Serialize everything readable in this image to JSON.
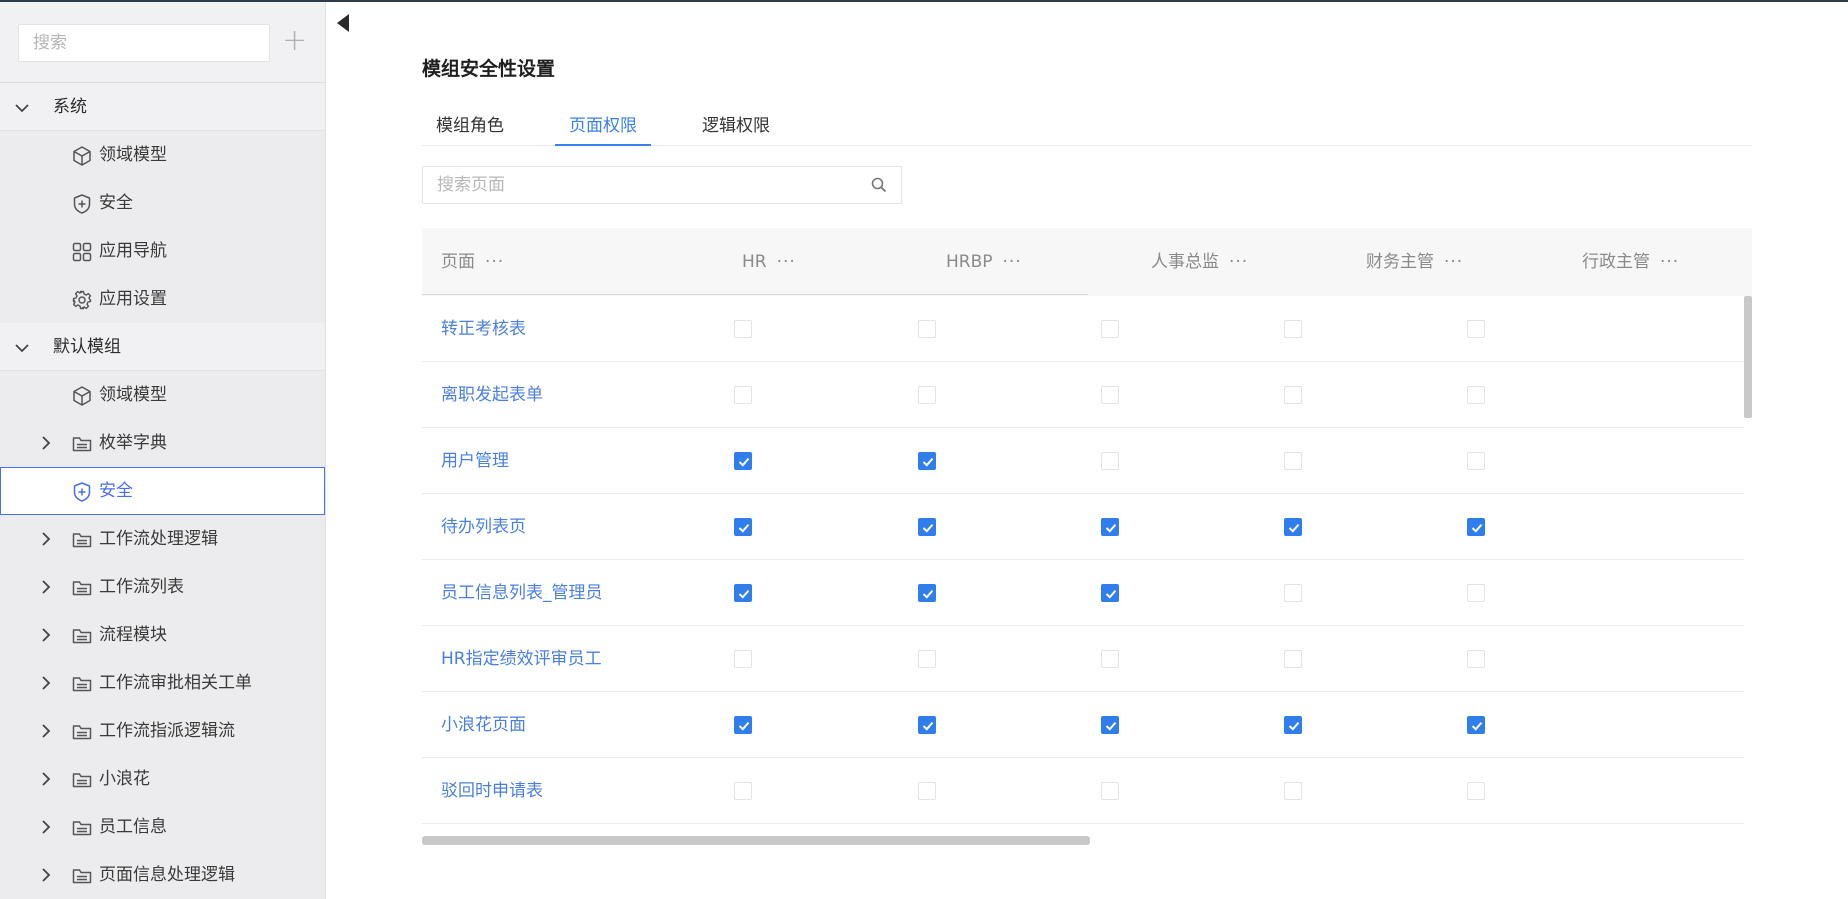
{
  "sidebar": {
    "search_placeholder": "搜索",
    "groups": [
      {
        "label": "系统",
        "items": [
          {
            "label": "领域模型",
            "icon": "cube-icon"
          },
          {
            "label": "安全",
            "icon": "shield-icon"
          },
          {
            "label": "应用导航",
            "icon": "grid-icon"
          },
          {
            "label": "应用设置",
            "icon": "gear-icon"
          }
        ]
      },
      {
        "label": "默认模组",
        "items": [
          {
            "label": "领域模型",
            "icon": "cube-icon"
          },
          {
            "label": "枚举字典",
            "icon": "folder-icon"
          },
          {
            "label": "安全",
            "icon": "shield-icon",
            "selected": true
          },
          {
            "label": "工作流处理逻辑",
            "icon": "folder-icon"
          },
          {
            "label": "工作流列表",
            "icon": "folder-icon"
          },
          {
            "label": "流程模块",
            "icon": "folder-icon"
          },
          {
            "label": "工作流审批相关工单",
            "icon": "folder-icon"
          },
          {
            "label": "工作流指派逻辑流",
            "icon": "folder-icon"
          },
          {
            "label": "小浪花",
            "icon": "folder-icon"
          },
          {
            "label": "员工信息",
            "icon": "folder-icon"
          },
          {
            "label": "页面信息处理逻辑",
            "icon": "folder-icon"
          }
        ]
      }
    ]
  },
  "main": {
    "title": "模组安全性设置",
    "tabs": [
      "模组角色",
      "页面权限",
      "逻辑权限"
    ],
    "active_tab": "页面权限",
    "search_placeholder": "搜索页面",
    "columns": [
      "页面",
      "HR",
      "HRBP",
      "人事总监",
      "财务主管",
      "行政主管"
    ],
    "more_glyph": "···",
    "rows": [
      {
        "page": "转正考核表",
        "perms": [
          false,
          false,
          false,
          false,
          false
        ]
      },
      {
        "page": "离职发起表单",
        "perms": [
          false,
          false,
          false,
          false,
          false
        ]
      },
      {
        "page": "用户管理",
        "perms": [
          true,
          true,
          false,
          false,
          false
        ]
      },
      {
        "page": "待办列表页",
        "perms": [
          true,
          true,
          true,
          true,
          true
        ]
      },
      {
        "page": "员工信息列表_管理员",
        "perms": [
          true,
          true,
          true,
          false,
          false
        ]
      },
      {
        "page": "HR指定绩效评审员工",
        "perms": [
          false,
          false,
          false,
          false,
          false
        ]
      },
      {
        "page": "小浪花页面",
        "perms": [
          true,
          true,
          true,
          true,
          true
        ]
      },
      {
        "page": "驳回时申请表",
        "perms": [
          false,
          false,
          false,
          false,
          false
        ]
      }
    ]
  },
  "colors": {
    "accent": "#3b7ff0",
    "checkbox": "#2f7eeb",
    "link": "#4a7fe0",
    "selected_border": "#4a6cf7"
  }
}
